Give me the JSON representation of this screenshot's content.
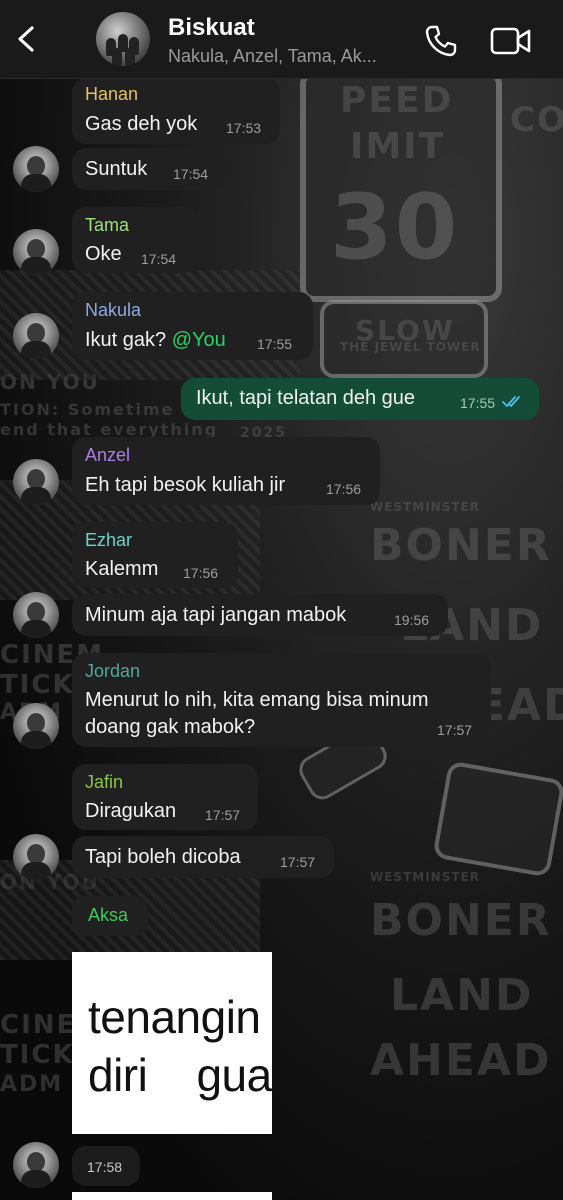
{
  "header": {
    "title": "Biskuat",
    "subtitle": "Nakula, Anzel, Tama, Ak..."
  },
  "wallpaper": {
    "speed": "PEED",
    "limit": "IMIT",
    "number": "30",
    "slow": "SLOW",
    "jewel": "THE JEWEL TOWER",
    "westminster": "WESTMINSTER",
    "boner": "BONER",
    "land": "LAND",
    "ahead": "AHEAD",
    "on_you": "ON YOU",
    "cinema": "CINEM",
    "tick": "TICK",
    "adm": "ADM",
    "caution": "TION: Sometime",
    "end_that": "end that everything",
    "year": "2025",
    "con": "CON"
  },
  "messages": [
    {
      "sender": "Hanan",
      "color": "#e6c25c",
      "text": "Gas deh yok",
      "time": "17:53"
    },
    {
      "sender": "",
      "color": "",
      "text": "Suntuk",
      "time": "17:54"
    },
    {
      "sender": "Tama",
      "color": "#9ee07a",
      "text": "Oke",
      "time": "17:54"
    },
    {
      "sender": "Nakula",
      "color": "#8fa9e0",
      "text": "Ikut gak? ",
      "mention": "@You",
      "time": "17:55"
    },
    {
      "sender": "",
      "color": "",
      "text": "Ikut, tapi telatan deh gue",
      "time": "17:55",
      "outgoing": true
    },
    {
      "sender": "Anzel",
      "color": "#b07de6",
      "text": "Eh tapi besok kuliah jir",
      "time": "17:56"
    },
    {
      "sender": "Ezhar",
      "color": "#6ad3c8",
      "text": "Kalemm",
      "time": "17:56"
    },
    {
      "sender": "",
      "color": "",
      "text": "Minum aja tapi jangan mabok",
      "time": "19:56"
    },
    {
      "sender": "Jordan",
      "color": "#4fa99a",
      "text1": "Menurut lo nih, kita emang bisa minum",
      "text2": "doang gak mabok?",
      "time": "17:57"
    },
    {
      "sender": "Jafin",
      "color": "#8ec43e",
      "text": "Diragukan",
      "time": "17:57"
    },
    {
      "sender": "",
      "color": "",
      "text": "Tapi boleh dicoba",
      "time": "17:57"
    },
    {
      "sender": "Aksa",
      "color": "#3fc957",
      "sticker_line1": "tenangin",
      "sticker_line2": "diri    gua",
      "time": "17:58"
    }
  ],
  "accent": "#25d366",
  "read_tick_color": "#53bdeb"
}
